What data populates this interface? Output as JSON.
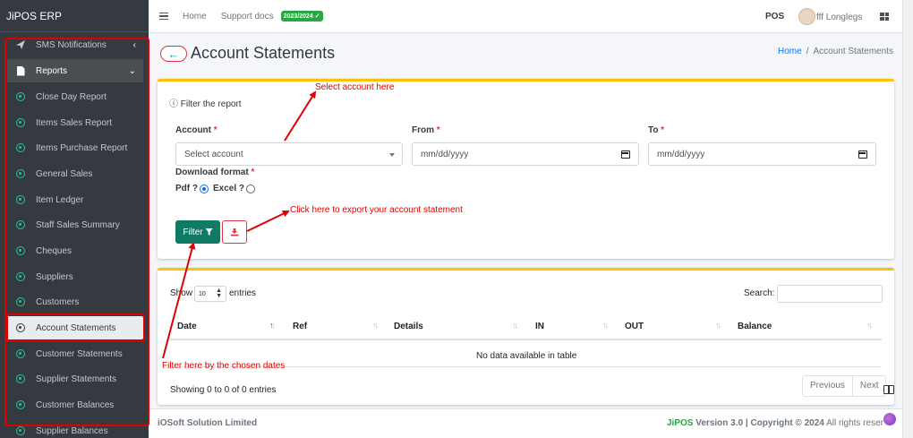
{
  "app": {
    "brand": "JiPOS ERP"
  },
  "sidebar": {
    "items": [
      {
        "label": "SMS Notifications",
        "kind": "top"
      },
      {
        "label": "Reports",
        "kind": "group"
      },
      {
        "label": "Close Day Report"
      },
      {
        "label": "Items Sales Report"
      },
      {
        "label": "Items Purchase Report"
      },
      {
        "label": "General Sales"
      },
      {
        "label": "Item Ledger"
      },
      {
        "label": "Staff Sales Summary"
      },
      {
        "label": "Cheques"
      },
      {
        "label": "Suppliers"
      },
      {
        "label": "Customers"
      },
      {
        "label": "Account Statements",
        "active": true
      },
      {
        "label": "Customer Statements"
      },
      {
        "label": "Supplier Statements"
      },
      {
        "label": "Customer Balances"
      },
      {
        "label": "Supplier Balances"
      }
    ]
  },
  "topbar": {
    "home": "Home",
    "support": "Support docs",
    "badge": "2023/2024",
    "pos": "POS",
    "user": "fff Longlegs"
  },
  "header": {
    "back": "←",
    "title": "Account Statements",
    "breadcrumb": {
      "home": "Home",
      "sep": "/",
      "current": "Account Statements"
    }
  },
  "filter": {
    "heading": "Filter the report",
    "account": {
      "label": "Account",
      "required": "*",
      "value": "Select account"
    },
    "from": {
      "label": "From",
      "required": "*",
      "value": "mm/dd/yyyy"
    },
    "to": {
      "label": "To",
      "required": "*",
      "value": "mm/dd/yyyy"
    },
    "format": {
      "label": "Download format",
      "required": "*",
      "pdf": "Pdf ?",
      "excel": "Excel ?",
      "selected": "pdf"
    },
    "filter_button": "Filter"
  },
  "table": {
    "show": "Show",
    "entries_value": "10",
    "entries": "entries",
    "search_label": "Search:",
    "columns": [
      "Date",
      "Ref",
      "Details",
      "IN",
      "OUT",
      "Balance"
    ],
    "empty": "No data available in table",
    "info": "Showing 0 to 0 of 0 entries",
    "prev": "Previous",
    "next": "Next"
  },
  "footer": {
    "company": "iOSoft Solution Limited",
    "brand": "JiPOS",
    "version": "Version 3.0",
    "sep": "|",
    "copyright": "Copyright © 2024",
    "rights": "All rights reser"
  },
  "annotations": {
    "select_account": "Select account here",
    "export": "Click here to export your account statement",
    "filter_dates": "Filter here by the chosen dates",
    "color": "#e00000"
  },
  "colors": {
    "sidebar": "#343a40",
    "accent": "#117a65",
    "card_top": "#ffc107",
    "danger": "#dc3545",
    "link": "#007bff"
  }
}
